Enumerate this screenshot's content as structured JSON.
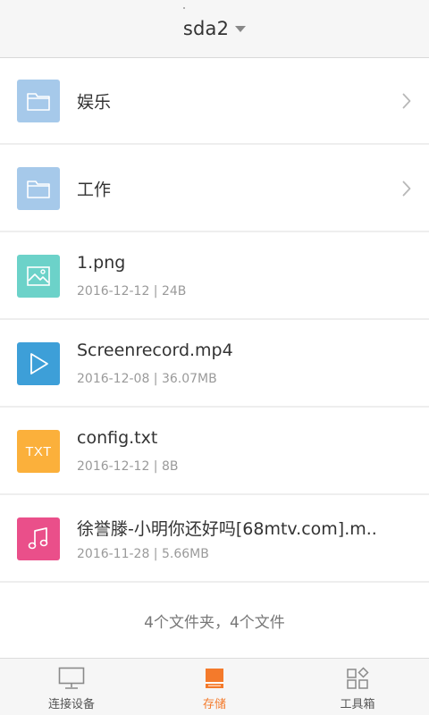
{
  "header": {
    "title": "sda2"
  },
  "items": [
    {
      "type": "folder",
      "icon": "folder-icon",
      "name": "娱乐"
    },
    {
      "type": "folder",
      "icon": "folder-icon",
      "name": "工作"
    },
    {
      "type": "file",
      "icon": "image-file-icon",
      "name": "1.png",
      "meta": "2016-12-12 | 24B"
    },
    {
      "type": "file",
      "icon": "video-file-icon",
      "name": "Screenrecord.mp4",
      "meta": "2016-12-08 | 36.07MB"
    },
    {
      "type": "file",
      "icon": "txt-file-icon",
      "icon_text": "TXT",
      "name": "config.txt",
      "meta": "2016-12-12 | 8B"
    },
    {
      "type": "file",
      "icon": "music-file-icon",
      "name": "徐誉滕-小明你还好吗[68mtv.com].m..",
      "meta": "2016-11-28 | 5.66MB"
    }
  ],
  "summary": "4个文件夹，4个文件",
  "nav": [
    {
      "label": "连接设备",
      "icon": "monitor-icon",
      "active": false
    },
    {
      "label": "存储",
      "icon": "storage-icon",
      "active": true
    },
    {
      "label": "工具箱",
      "icon": "toolbox-icon",
      "active": false
    }
  ],
  "colors": {
    "accent": "#f47a2b",
    "folder": "#a6c9ea",
    "image": "#6cd2c9",
    "video": "#3d9fd8",
    "txt": "#fbb03b",
    "music": "#ea4f8a"
  }
}
